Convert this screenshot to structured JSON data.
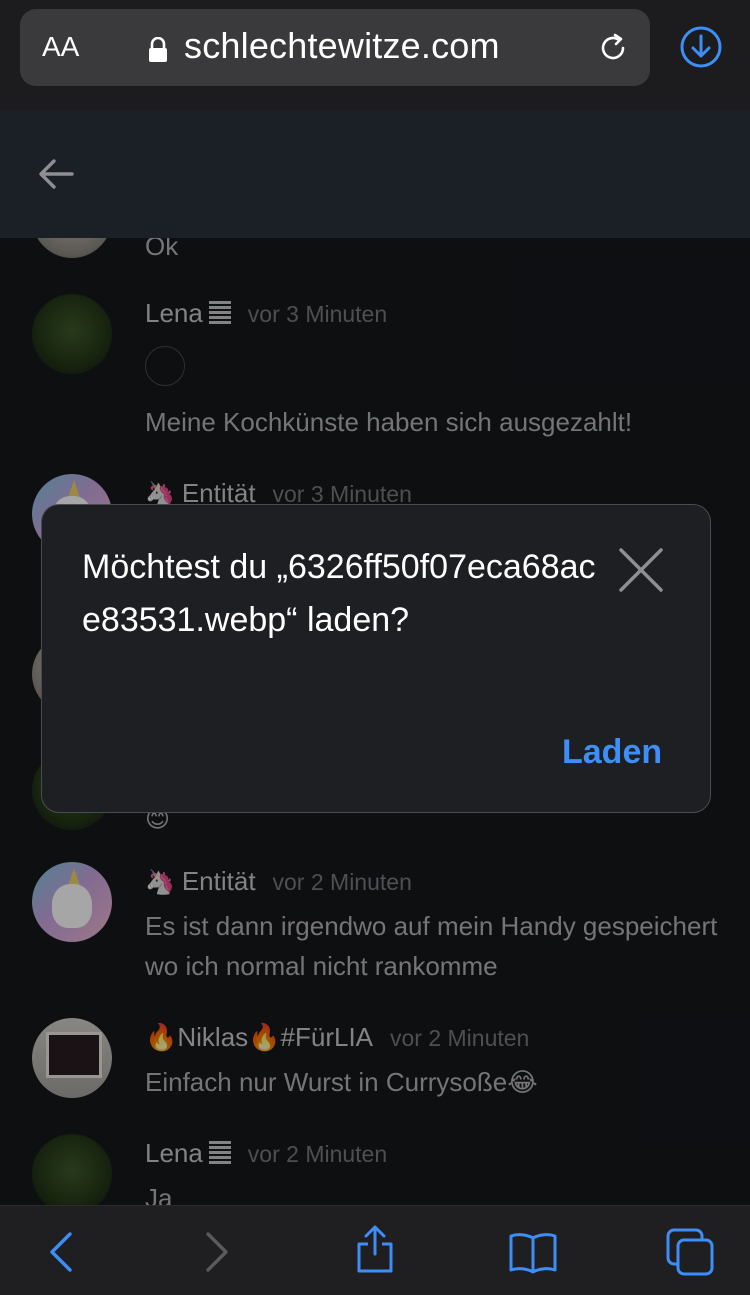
{
  "browser": {
    "text_size_button": "AA",
    "domain": "schlechtewitze.com"
  },
  "feed": {
    "items": [
      {
        "message": "Ok"
      },
      {
        "name": "Lena",
        "time": "vor 3 Minuten",
        "message": "Meine Kochkünste haben sich ausgezahlt!"
      },
      {
        "name_prefix": "🦄",
        "name": "Entität",
        "time": "vor 3 Minuten"
      },
      {
        "message": "😊"
      },
      {
        "name_prefix": "🦄",
        "name": "Entität",
        "time": "vor 2 Minuten",
        "message": "Es ist dann irgendwo auf mein Handy gespeichert wo ich normal nicht rankomme"
      },
      {
        "name": "🔥Niklas🔥#FürLIA",
        "time": "vor 2 Minuten",
        "message": "Einfach nur Wurst in Currysoße😂"
      },
      {
        "name": "Lena",
        "time": "vor 2 Minuten",
        "message": "Ja"
      }
    ]
  },
  "dialog": {
    "title": "Möchtest du „6326ff50f07eca68ace83531.webp“ laden?",
    "load_label": "Laden"
  },
  "colors": {
    "accent": "#3e8ef7",
    "background": "#16171b",
    "dialog_bg": "#1e1f23"
  }
}
